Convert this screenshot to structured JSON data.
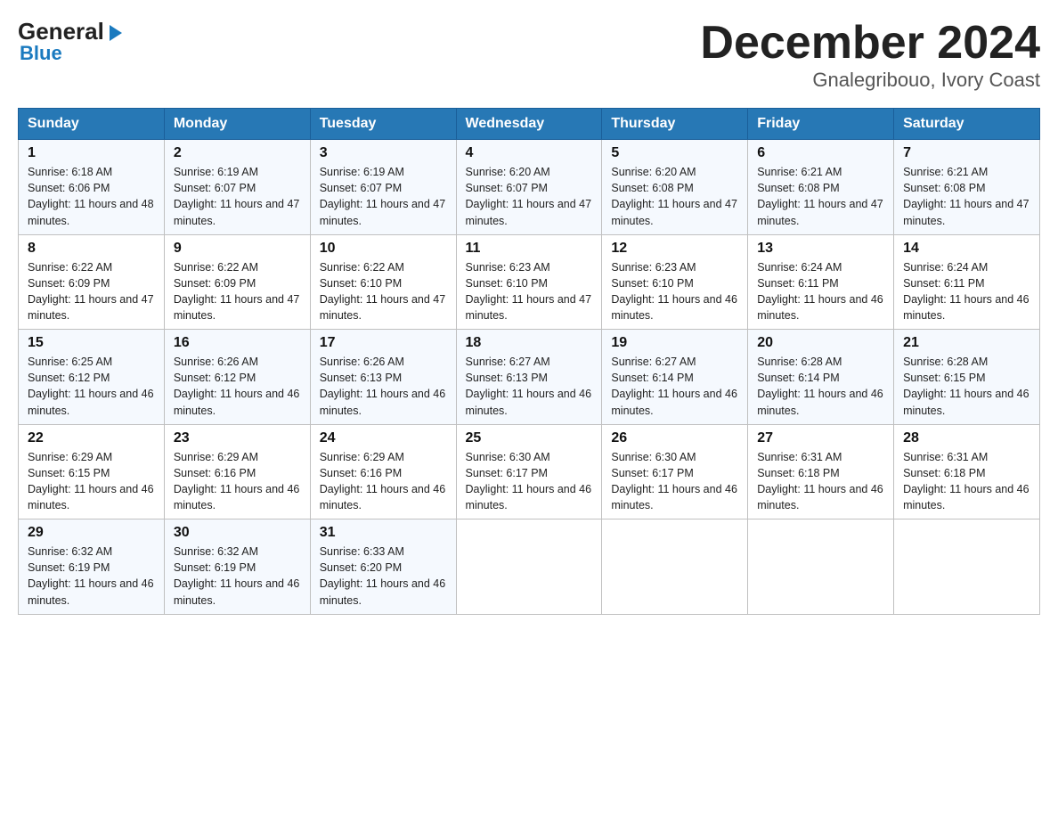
{
  "logo": {
    "general": "General",
    "blue": "Blue",
    "arrow": "▶"
  },
  "title": "December 2024",
  "subtitle": "Gnalegribouo, Ivory Coast",
  "headers": [
    "Sunday",
    "Monday",
    "Tuesday",
    "Wednesday",
    "Thursday",
    "Friday",
    "Saturday"
  ],
  "weeks": [
    [
      {
        "day": "1",
        "sunrise": "6:18 AM",
        "sunset": "6:06 PM",
        "daylight": "11 hours and 48 minutes."
      },
      {
        "day": "2",
        "sunrise": "6:19 AM",
        "sunset": "6:07 PM",
        "daylight": "11 hours and 47 minutes."
      },
      {
        "day": "3",
        "sunrise": "6:19 AM",
        "sunset": "6:07 PM",
        "daylight": "11 hours and 47 minutes."
      },
      {
        "day": "4",
        "sunrise": "6:20 AM",
        "sunset": "6:07 PM",
        "daylight": "11 hours and 47 minutes."
      },
      {
        "day": "5",
        "sunrise": "6:20 AM",
        "sunset": "6:08 PM",
        "daylight": "11 hours and 47 minutes."
      },
      {
        "day": "6",
        "sunrise": "6:21 AM",
        "sunset": "6:08 PM",
        "daylight": "11 hours and 47 minutes."
      },
      {
        "day": "7",
        "sunrise": "6:21 AM",
        "sunset": "6:08 PM",
        "daylight": "11 hours and 47 minutes."
      }
    ],
    [
      {
        "day": "8",
        "sunrise": "6:22 AM",
        "sunset": "6:09 PM",
        "daylight": "11 hours and 47 minutes."
      },
      {
        "day": "9",
        "sunrise": "6:22 AM",
        "sunset": "6:09 PM",
        "daylight": "11 hours and 47 minutes."
      },
      {
        "day": "10",
        "sunrise": "6:22 AM",
        "sunset": "6:10 PM",
        "daylight": "11 hours and 47 minutes."
      },
      {
        "day": "11",
        "sunrise": "6:23 AM",
        "sunset": "6:10 PM",
        "daylight": "11 hours and 47 minutes."
      },
      {
        "day": "12",
        "sunrise": "6:23 AM",
        "sunset": "6:10 PM",
        "daylight": "11 hours and 46 minutes."
      },
      {
        "day": "13",
        "sunrise": "6:24 AM",
        "sunset": "6:11 PM",
        "daylight": "11 hours and 46 minutes."
      },
      {
        "day": "14",
        "sunrise": "6:24 AM",
        "sunset": "6:11 PM",
        "daylight": "11 hours and 46 minutes."
      }
    ],
    [
      {
        "day": "15",
        "sunrise": "6:25 AM",
        "sunset": "6:12 PM",
        "daylight": "11 hours and 46 minutes."
      },
      {
        "day": "16",
        "sunrise": "6:26 AM",
        "sunset": "6:12 PM",
        "daylight": "11 hours and 46 minutes."
      },
      {
        "day": "17",
        "sunrise": "6:26 AM",
        "sunset": "6:13 PM",
        "daylight": "11 hours and 46 minutes."
      },
      {
        "day": "18",
        "sunrise": "6:27 AM",
        "sunset": "6:13 PM",
        "daylight": "11 hours and 46 minutes."
      },
      {
        "day": "19",
        "sunrise": "6:27 AM",
        "sunset": "6:14 PM",
        "daylight": "11 hours and 46 minutes."
      },
      {
        "day": "20",
        "sunrise": "6:28 AM",
        "sunset": "6:14 PM",
        "daylight": "11 hours and 46 minutes."
      },
      {
        "day": "21",
        "sunrise": "6:28 AM",
        "sunset": "6:15 PM",
        "daylight": "11 hours and 46 minutes."
      }
    ],
    [
      {
        "day": "22",
        "sunrise": "6:29 AM",
        "sunset": "6:15 PM",
        "daylight": "11 hours and 46 minutes."
      },
      {
        "day": "23",
        "sunrise": "6:29 AM",
        "sunset": "6:16 PM",
        "daylight": "11 hours and 46 minutes."
      },
      {
        "day": "24",
        "sunrise": "6:29 AM",
        "sunset": "6:16 PM",
        "daylight": "11 hours and 46 minutes."
      },
      {
        "day": "25",
        "sunrise": "6:30 AM",
        "sunset": "6:17 PM",
        "daylight": "11 hours and 46 minutes."
      },
      {
        "day": "26",
        "sunrise": "6:30 AM",
        "sunset": "6:17 PM",
        "daylight": "11 hours and 46 minutes."
      },
      {
        "day": "27",
        "sunrise": "6:31 AM",
        "sunset": "6:18 PM",
        "daylight": "11 hours and 46 minutes."
      },
      {
        "day": "28",
        "sunrise": "6:31 AM",
        "sunset": "6:18 PM",
        "daylight": "11 hours and 46 minutes."
      }
    ],
    [
      {
        "day": "29",
        "sunrise": "6:32 AM",
        "sunset": "6:19 PM",
        "daylight": "11 hours and 46 minutes."
      },
      {
        "day": "30",
        "sunrise": "6:32 AM",
        "sunset": "6:19 PM",
        "daylight": "11 hours and 46 minutes."
      },
      {
        "day": "31",
        "sunrise": "6:33 AM",
        "sunset": "6:20 PM",
        "daylight": "11 hours and 46 minutes."
      },
      null,
      null,
      null,
      null
    ]
  ]
}
